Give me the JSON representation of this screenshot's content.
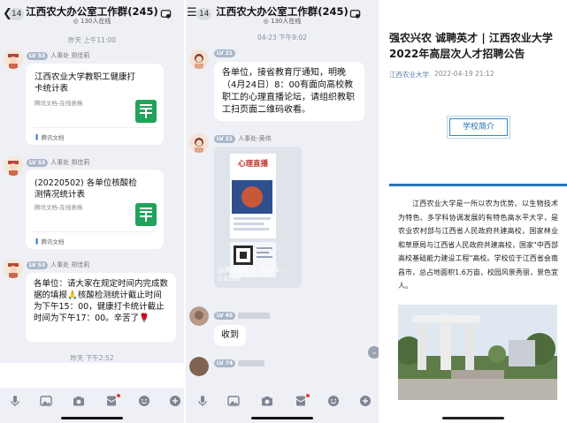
{
  "group": {
    "title": "江西农大办公室工作群(245)",
    "members": "130人在线",
    "unread": "14"
  },
  "panel1": {
    "time_top": "昨天 上午11:00",
    "sender_level": "LV 53",
    "sender_name": "人事处 郑佳莉",
    "card1": {
      "title": "江西农业大学教职工健康打卡统计表",
      "source": "腾讯文档-在线表格",
      "brand": "腾讯文档"
    },
    "card2": {
      "title": "(20220502) 各单位核酸检测情况统计表",
      "source": "腾讯文档-在线表格",
      "brand": "腾讯文档"
    },
    "message": "各单位：请大家在规定时间内完成数据的填报🙏核酸检测统计截止时间为下午15：00，健康打卡统计截止时间为下午17：00。辛苦了🌹",
    "time_bottom": "昨天 下午2:52"
  },
  "panel2": {
    "date": "04-23 下午9:02",
    "level": "LV 21",
    "notice": "各单位，接省教育厅通知，明晚（4月24日）8：00有面向高校教职工的心理直播论坛，请组织教职工扫页面二维码收看。",
    "sender_name": "人事处-黄伟",
    "poster_heading": "心理直播",
    "file_caption": "@高校教职工-4月24...",
    "file_size": "1.42MB",
    "level_3": "LV 45",
    "received": "收到",
    "level_4": "LV 74"
  },
  "article": {
    "title": "强农兴农 诚聘英才 | 江西农业大学2022年高层次人才招聘公告",
    "source": "江西农业大学",
    "date": "2022-04-19 21:12",
    "section_label": "学校简介",
    "body": "江西农业大学是一所以农为优势、以生物技术为特色、多学科协调发展的有特色高水平大学，是农业农村部与江西省人民政府共建高校，国家林业和草原局与江西省人民政府共建高校，国家\"中西部高校基础能力建设工程\"高校。学校位于江西省会南昌市，总占地面积1.6万亩，校园风景秀丽，景色宜人。"
  },
  "colors": {
    "chat_bg": "#eef0f5",
    "accent_blue": "#2a73b8",
    "sheet_green": "#20a35a",
    "notify_red": "#e3402f"
  }
}
